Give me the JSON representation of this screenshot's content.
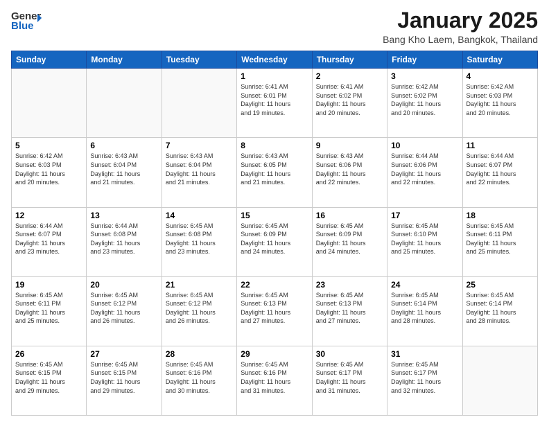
{
  "header": {
    "logo_general": "General",
    "logo_blue": "Blue",
    "month": "January 2025",
    "location": "Bang Kho Laem, Bangkok, Thailand"
  },
  "weekdays": [
    "Sunday",
    "Monday",
    "Tuesday",
    "Wednesday",
    "Thursday",
    "Friday",
    "Saturday"
  ],
  "weeks": [
    [
      {
        "day": "",
        "info": ""
      },
      {
        "day": "",
        "info": ""
      },
      {
        "day": "",
        "info": ""
      },
      {
        "day": "1",
        "info": "Sunrise: 6:41 AM\nSunset: 6:01 PM\nDaylight: 11 hours\nand 19 minutes."
      },
      {
        "day": "2",
        "info": "Sunrise: 6:41 AM\nSunset: 6:02 PM\nDaylight: 11 hours\nand 20 minutes."
      },
      {
        "day": "3",
        "info": "Sunrise: 6:42 AM\nSunset: 6:02 PM\nDaylight: 11 hours\nand 20 minutes."
      },
      {
        "day": "4",
        "info": "Sunrise: 6:42 AM\nSunset: 6:03 PM\nDaylight: 11 hours\nand 20 minutes."
      }
    ],
    [
      {
        "day": "5",
        "info": "Sunrise: 6:42 AM\nSunset: 6:03 PM\nDaylight: 11 hours\nand 20 minutes."
      },
      {
        "day": "6",
        "info": "Sunrise: 6:43 AM\nSunset: 6:04 PM\nDaylight: 11 hours\nand 21 minutes."
      },
      {
        "day": "7",
        "info": "Sunrise: 6:43 AM\nSunset: 6:04 PM\nDaylight: 11 hours\nand 21 minutes."
      },
      {
        "day": "8",
        "info": "Sunrise: 6:43 AM\nSunset: 6:05 PM\nDaylight: 11 hours\nand 21 minutes."
      },
      {
        "day": "9",
        "info": "Sunrise: 6:43 AM\nSunset: 6:06 PM\nDaylight: 11 hours\nand 22 minutes."
      },
      {
        "day": "10",
        "info": "Sunrise: 6:44 AM\nSunset: 6:06 PM\nDaylight: 11 hours\nand 22 minutes."
      },
      {
        "day": "11",
        "info": "Sunrise: 6:44 AM\nSunset: 6:07 PM\nDaylight: 11 hours\nand 22 minutes."
      }
    ],
    [
      {
        "day": "12",
        "info": "Sunrise: 6:44 AM\nSunset: 6:07 PM\nDaylight: 11 hours\nand 23 minutes."
      },
      {
        "day": "13",
        "info": "Sunrise: 6:44 AM\nSunset: 6:08 PM\nDaylight: 11 hours\nand 23 minutes."
      },
      {
        "day": "14",
        "info": "Sunrise: 6:45 AM\nSunset: 6:08 PM\nDaylight: 11 hours\nand 23 minutes."
      },
      {
        "day": "15",
        "info": "Sunrise: 6:45 AM\nSunset: 6:09 PM\nDaylight: 11 hours\nand 24 minutes."
      },
      {
        "day": "16",
        "info": "Sunrise: 6:45 AM\nSunset: 6:09 PM\nDaylight: 11 hours\nand 24 minutes."
      },
      {
        "day": "17",
        "info": "Sunrise: 6:45 AM\nSunset: 6:10 PM\nDaylight: 11 hours\nand 25 minutes."
      },
      {
        "day": "18",
        "info": "Sunrise: 6:45 AM\nSunset: 6:11 PM\nDaylight: 11 hours\nand 25 minutes."
      }
    ],
    [
      {
        "day": "19",
        "info": "Sunrise: 6:45 AM\nSunset: 6:11 PM\nDaylight: 11 hours\nand 25 minutes."
      },
      {
        "day": "20",
        "info": "Sunrise: 6:45 AM\nSunset: 6:12 PM\nDaylight: 11 hours\nand 26 minutes."
      },
      {
        "day": "21",
        "info": "Sunrise: 6:45 AM\nSunset: 6:12 PM\nDaylight: 11 hours\nand 26 minutes."
      },
      {
        "day": "22",
        "info": "Sunrise: 6:45 AM\nSunset: 6:13 PM\nDaylight: 11 hours\nand 27 minutes."
      },
      {
        "day": "23",
        "info": "Sunrise: 6:45 AM\nSunset: 6:13 PM\nDaylight: 11 hours\nand 27 minutes."
      },
      {
        "day": "24",
        "info": "Sunrise: 6:45 AM\nSunset: 6:14 PM\nDaylight: 11 hours\nand 28 minutes."
      },
      {
        "day": "25",
        "info": "Sunrise: 6:45 AM\nSunset: 6:14 PM\nDaylight: 11 hours\nand 28 minutes."
      }
    ],
    [
      {
        "day": "26",
        "info": "Sunrise: 6:45 AM\nSunset: 6:15 PM\nDaylight: 11 hours\nand 29 minutes."
      },
      {
        "day": "27",
        "info": "Sunrise: 6:45 AM\nSunset: 6:15 PM\nDaylight: 11 hours\nand 29 minutes."
      },
      {
        "day": "28",
        "info": "Sunrise: 6:45 AM\nSunset: 6:16 PM\nDaylight: 11 hours\nand 30 minutes."
      },
      {
        "day": "29",
        "info": "Sunrise: 6:45 AM\nSunset: 6:16 PM\nDaylight: 11 hours\nand 31 minutes."
      },
      {
        "day": "30",
        "info": "Sunrise: 6:45 AM\nSunset: 6:17 PM\nDaylight: 11 hours\nand 31 minutes."
      },
      {
        "day": "31",
        "info": "Sunrise: 6:45 AM\nSunset: 6:17 PM\nDaylight: 11 hours\nand 32 minutes."
      },
      {
        "day": "",
        "info": ""
      }
    ]
  ]
}
